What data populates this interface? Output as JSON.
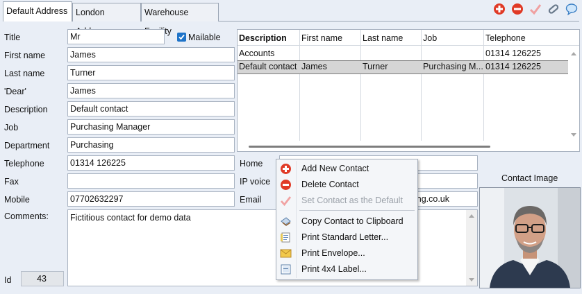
{
  "tabs": [
    "Default Address",
    "London Address",
    "Warehouse Facility"
  ],
  "toolbar": {
    "icons": [
      "add-icon",
      "delete-icon",
      "set-default-icon",
      "attach-icon",
      "comment-icon"
    ]
  },
  "form": {
    "title_label": "Title",
    "title_value": "Mr",
    "mailable_label": "Mailable",
    "mailable_checked": true,
    "first_name_label": "First name",
    "first_name_value": "James",
    "last_name_label": "Last name",
    "last_name_value": "Turner",
    "dear_label": "'Dear'",
    "dear_value": "James",
    "description_label": "Description",
    "description_value": "Default contact",
    "job_label": "Job",
    "job_value": "Purchasing Manager",
    "department_label": "Department",
    "department_value": "Purchasing",
    "telephone_label": "Telephone",
    "telephone_value": "01314 126225",
    "fax_label": "Fax",
    "fax_value": "",
    "mobile_label": "Mobile",
    "mobile_value": "07702632297",
    "home_label": "Home",
    "home_value": "",
    "ipvoice_label": "IP voice",
    "ipvoice_value": "",
    "email_label": "Email",
    "email_value": "ing.co.uk",
    "comments_label": "Comments:",
    "comments_value": "Fictitious contact for demo data",
    "id_label": "Id",
    "id_value": "43"
  },
  "grid": {
    "headers": [
      "Description",
      "First name",
      "Last name",
      "Job",
      "Telephone"
    ],
    "rows": [
      [
        "Accounts",
        "",
        "",
        "",
        "01314 126225"
      ],
      [
        "Default contact",
        "James",
        "Turner",
        "Purchasing M...",
        "01314 126225"
      ]
    ]
  },
  "contact_image_label": "Contact Image",
  "context_menu": {
    "items": [
      {
        "label": "Add New Contact",
        "icon": "add-icon",
        "enabled": true
      },
      {
        "label": "Delete Contact",
        "icon": "delete-icon",
        "enabled": true
      },
      {
        "label": "Set Contact as the Default",
        "icon": "checkmark-icon",
        "enabled": false
      },
      {
        "label": "Copy Contact to Clipboard",
        "icon": "clipboard-icon",
        "enabled": true
      },
      {
        "label": "Print Standard Letter...",
        "icon": "letter-icon",
        "enabled": true
      },
      {
        "label": "Print Envelope...",
        "icon": "envelope-icon",
        "enabled": true
      },
      {
        "label": "Print 4x4 Label...",
        "icon": "label-icon",
        "enabled": true
      }
    ]
  }
}
